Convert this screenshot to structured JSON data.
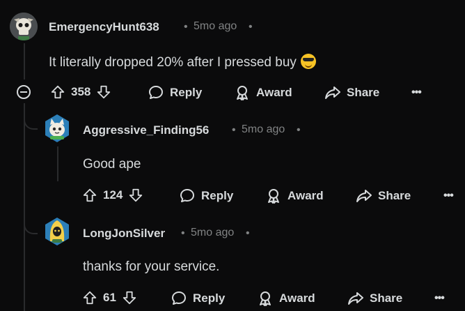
{
  "comments": [
    {
      "username": "EmergencyHunt638",
      "time": "5mo ago",
      "text": "It literally dropped 20% after I pressed buy",
      "emoji": "sunglasses-emoji",
      "votes": "358",
      "reply_label": "Reply",
      "award_label": "Award",
      "share_label": "Share",
      "more_label": "•••"
    },
    {
      "username": "Aggressive_Finding56",
      "time": "5mo ago",
      "text": "Good ape",
      "votes": "124",
      "reply_label": "Reply",
      "award_label": "Award",
      "share_label": "Share",
      "more_label": "•••"
    },
    {
      "username": "LongJonSilver",
      "time": "5mo ago",
      "text": "thanks for your service.",
      "votes": "61",
      "reply_label": "Reply",
      "award_label": "Award",
      "share_label": "Share",
      "more_label": "•••"
    }
  ],
  "separator": "•",
  "colors": {
    "background": "#0b0b0c",
    "text": "#d7dadc",
    "meta": "#818384",
    "thread_line": "#2a2b2d"
  }
}
